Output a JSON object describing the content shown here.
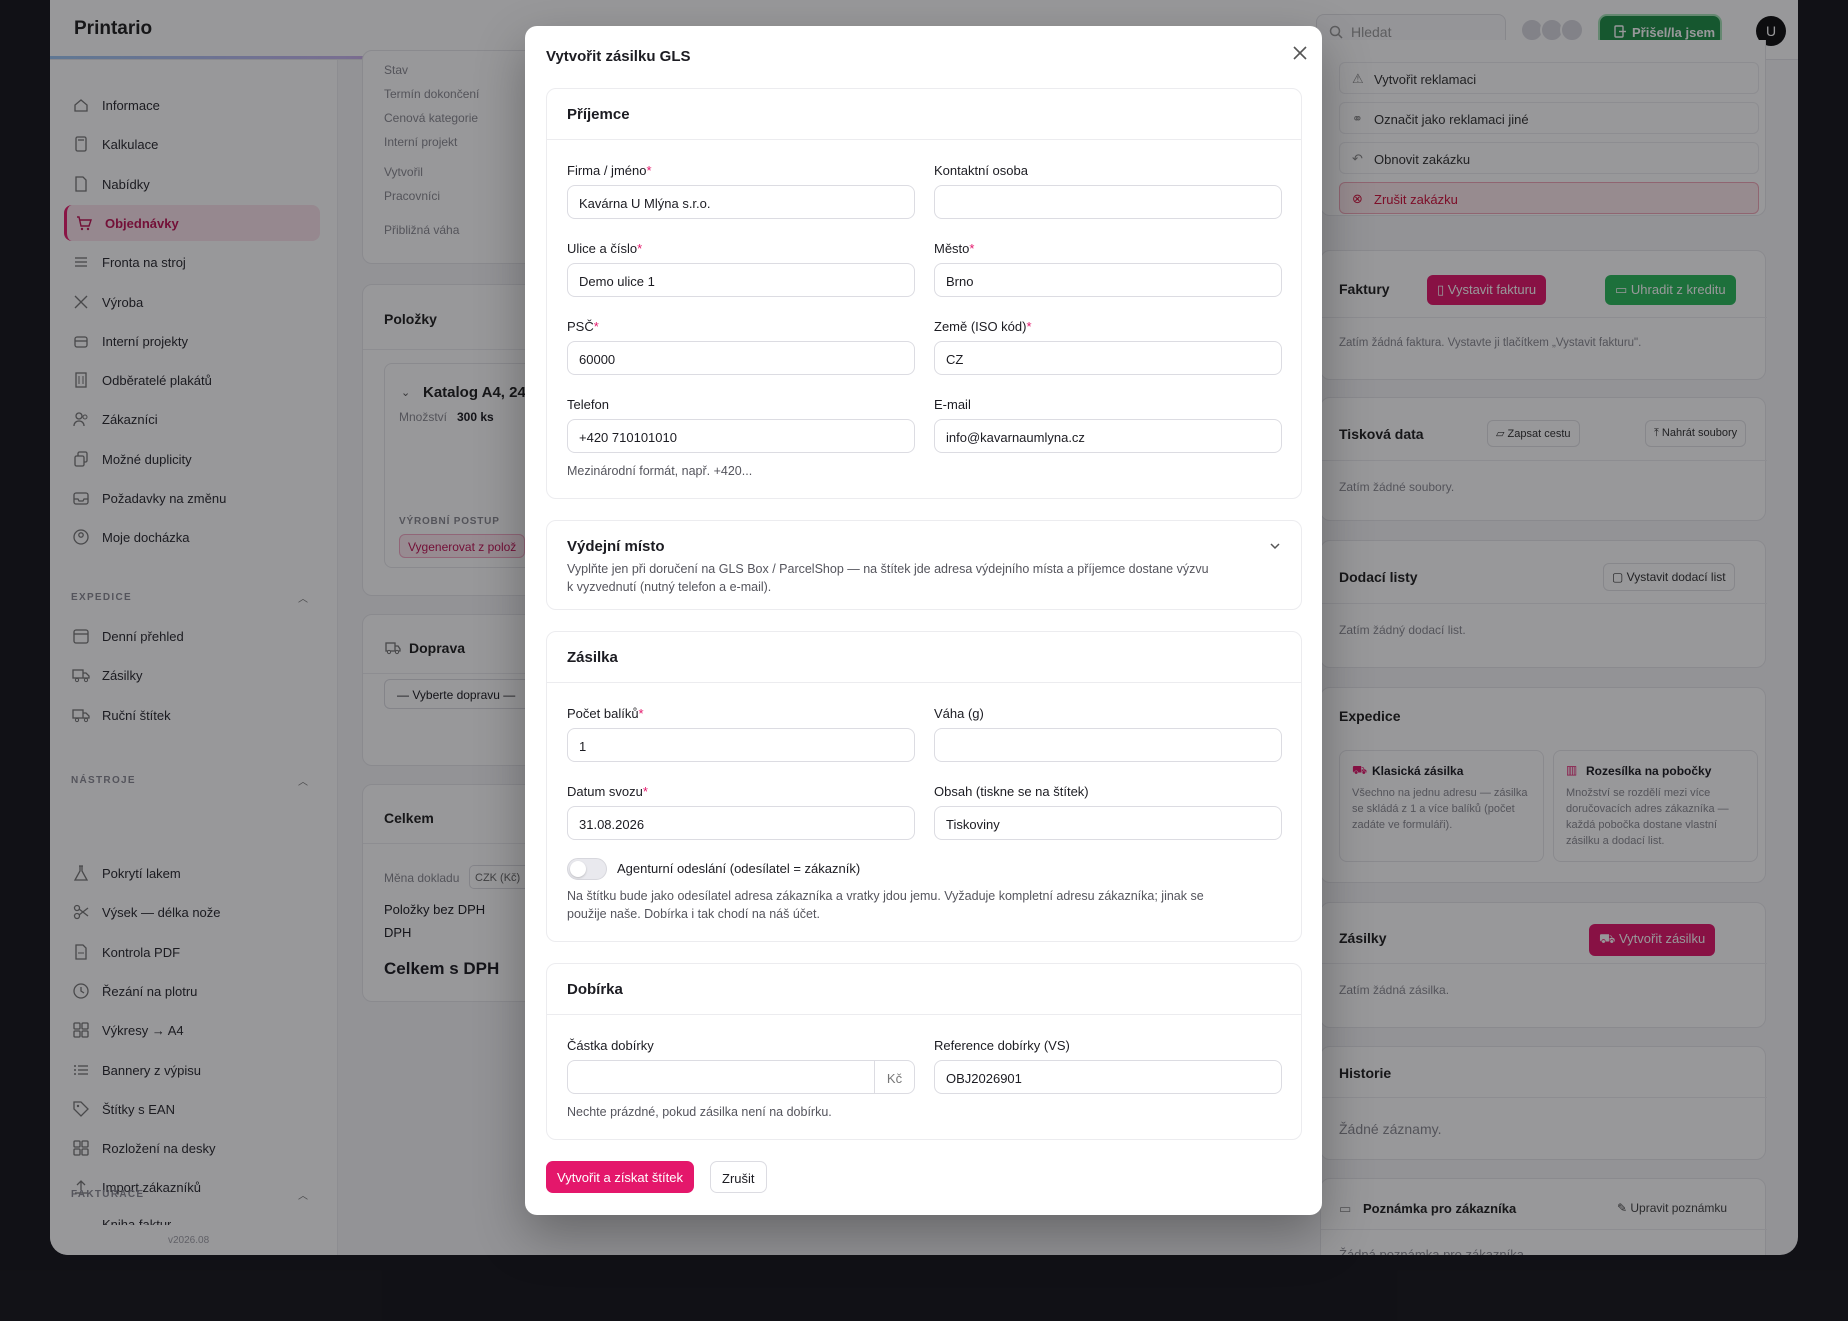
{
  "app": {
    "brand": "Printario",
    "search_placeholder": "Hledat",
    "arrived_button": "Přišel/la jsem",
    "user_initial": "U",
    "version": "v2026.08"
  },
  "sidebar": {
    "main_items": [
      {
        "label": "Informace",
        "icon": "info-icon"
      },
      {
        "label": "Kalkulace",
        "icon": "calculator-icon"
      },
      {
        "label": "Nabídky",
        "icon": "document-icon"
      },
      {
        "label": "Objednávky",
        "icon": "cart-icon",
        "active": true
      },
      {
        "label": "Fronta na stroj",
        "icon": "queue-icon"
      },
      {
        "label": "Výroba",
        "icon": "tools-icon"
      },
      {
        "label": "Interní projekty",
        "icon": "box-icon"
      },
      {
        "label": "Odběratelé plakátů",
        "icon": "building-icon"
      },
      {
        "label": "Zákazníci",
        "icon": "users-icon"
      },
      {
        "label": "Možné duplicity",
        "icon": "copy-icon"
      },
      {
        "label": "Požadavky na změnu",
        "icon": "inbox-icon"
      },
      {
        "label": "Moje docházka",
        "icon": "user-circle-icon"
      }
    ],
    "expedice_title": "EXPEDICE",
    "expedice_items": [
      {
        "label": "Denní přehled",
        "icon": "calendar-icon"
      },
      {
        "label": "Zásilky",
        "icon": "truck-icon"
      },
      {
        "label": "Ruční štítek",
        "icon": "truck-icon"
      }
    ],
    "nastroje_title": "NÁSTROJE",
    "nastroje_items": [
      {
        "label": "Pokrytí lakem",
        "icon": "flask-icon"
      },
      {
        "label": "Výsek — délka nože",
        "icon": "scissors-icon"
      },
      {
        "label": "Kontrola PDF",
        "icon": "pdf-icon"
      },
      {
        "label": "Řezání na plotru",
        "icon": "clock-icon"
      },
      {
        "label": "Výkresy → A4",
        "icon": "grid-icon"
      },
      {
        "label": "Bannery z výpisu",
        "icon": "list-icon"
      },
      {
        "label": "Štítky s EAN",
        "icon": "tag-icon"
      },
      {
        "label": "Rozložení na desky",
        "icon": "grid-icon"
      },
      {
        "label": "Import zákazníků",
        "icon": "upload-icon"
      }
    ],
    "fakturace_title": "FAKTURACE",
    "fakturace_partial": "Kniha faktur"
  },
  "order": {
    "info_labels": [
      "Stav",
      "Termín dokončení",
      "Cenová kategorie",
      "Interní projekt",
      "Vytvořil",
      "Pracovníci",
      "Přibližná váha"
    ],
    "items_title": "Položky",
    "item_name": "Katalog A4, 24",
    "qty_label": "Množství",
    "qty_value": "300 ks",
    "process_label": "VÝROBNÍ POSTUP",
    "process_button": "Vygenerovat z polož",
    "transport_title": "Doprava",
    "transport_select": "— Vyberte dopravu —",
    "total_title": "Celkem",
    "currency_label": "Měna dokladu",
    "currency_value": "CZK (Kč)",
    "no_vat": "Položky bez DPH",
    "vat": "DPH",
    "with_vat": "Celkem s DPH"
  },
  "right": {
    "actions": [
      "Vytvořit reklamaci",
      "Označit jako reklamaci jiné",
      "Obnovit zakázku",
      "Zrušit zakázku"
    ],
    "invoices_title": "Faktury",
    "issue_invoice": "Vystavit fakturu",
    "pay_credit": "Uhradit z kreditu",
    "invoices_empty": "Zatím žádná faktura. Vystavte ji tlačítkem „Vystavit fakturu\".",
    "print_title": "Tisková data",
    "write_path": "Zapsat cestu",
    "upload_files": "Nahrát soubory",
    "print_empty": "Zatím žádné soubory.",
    "delivery_title": "Dodací listy",
    "issue_delivery": "Vystavit dodací list",
    "delivery_empty": "Zatím žádný dodací list.",
    "expedice_title": "Expedice",
    "classic_title": "Klasická zásilka",
    "classic_desc": "Všechno na jednu adresu — zásilka se skládá z 1 a více balíků (počet zadáte ve formuláři).",
    "branch_title": "Rozesílka na pobočky",
    "branch_desc": "Množství se rozdělí mezi více doručovacích adres zákazníka — každá pobočka dostane vlastní zásilku a dodací list.",
    "shipments_title": "Zásilky",
    "create_shipment": "Vytvořit zásilku",
    "shipments_empty": "Zatím žádná zásilka.",
    "history_title": "Historie",
    "history_empty": "Žádné záznamy.",
    "note_title": "Poznámka pro zákazníka",
    "edit_note": "Upravit poznámku",
    "note_empty": "Žádná poznámka pro zákazníka"
  },
  "modal": {
    "title": "Vytvořit zásilku GLS",
    "recipient": {
      "title": "Příjemce",
      "company_label": "Firma / jméno",
      "company_value": "Kavárna U Mlýna s.r.o.",
      "contact_label": "Kontaktní osoba",
      "contact_value": "",
      "street_label": "Ulice a číslo",
      "street_value": "Demo ulice 1",
      "city_label": "Město",
      "city_value": "Brno",
      "zip_label": "PSČ",
      "zip_value": "60000",
      "country_label": "Země (ISO kód)",
      "country_value": "CZ",
      "phone_label": "Telefon",
      "phone_value": "+420 710101010",
      "email_label": "E-mail",
      "email_value": "info@kavarnaumlyna.cz",
      "phone_hint": "Mezinárodní formát, např. +420..."
    },
    "pickup": {
      "title": "Výdejní místo",
      "desc_1": "Vyplňte jen při doručení na GLS Box / ParcelShop — na štítek jde adresa výdejního místa a příjemce dostane výzvu",
      "desc_2": "k vyzvednutí (nutný telefon a e-mail)."
    },
    "shipment": {
      "title": "Zásilka",
      "count_label": "Počet balíků",
      "count_value": "1",
      "weight_label": "Váha (g)",
      "weight_value": "",
      "date_label": "Datum svozu",
      "date_value": "31.08.2026",
      "content_label": "Obsah (tiskne se na štítek)",
      "content_value": "Tiskoviny",
      "agency_label": "Agenturní odeslání (odesílatel = zákazník)",
      "agency_hint_1": "Na štítku bude jako odesílatel adresa zákazníka a vratky jdou jemu. Vyžaduje kompletní adresu zákazníka; jinak se",
      "agency_hint_2": "použije naše. Dobírka i tak chodí na náš účet."
    },
    "cod": {
      "title": "Dobírka",
      "amount_label": "Částka dobírky",
      "amount_value": "",
      "unit": "Kč",
      "ref_label": "Reference dobírky (VS)",
      "ref_value": "OBJ2026901",
      "hint": "Nechte prázdné, pokud zásilka není na dobírku."
    },
    "submit": "Vytvořit a získat štítek",
    "cancel": "Zrušit"
  },
  "colors": {
    "accent": "#e4176b",
    "green": "#2cbb5c",
    "danger_bg": "#fde8ec"
  }
}
